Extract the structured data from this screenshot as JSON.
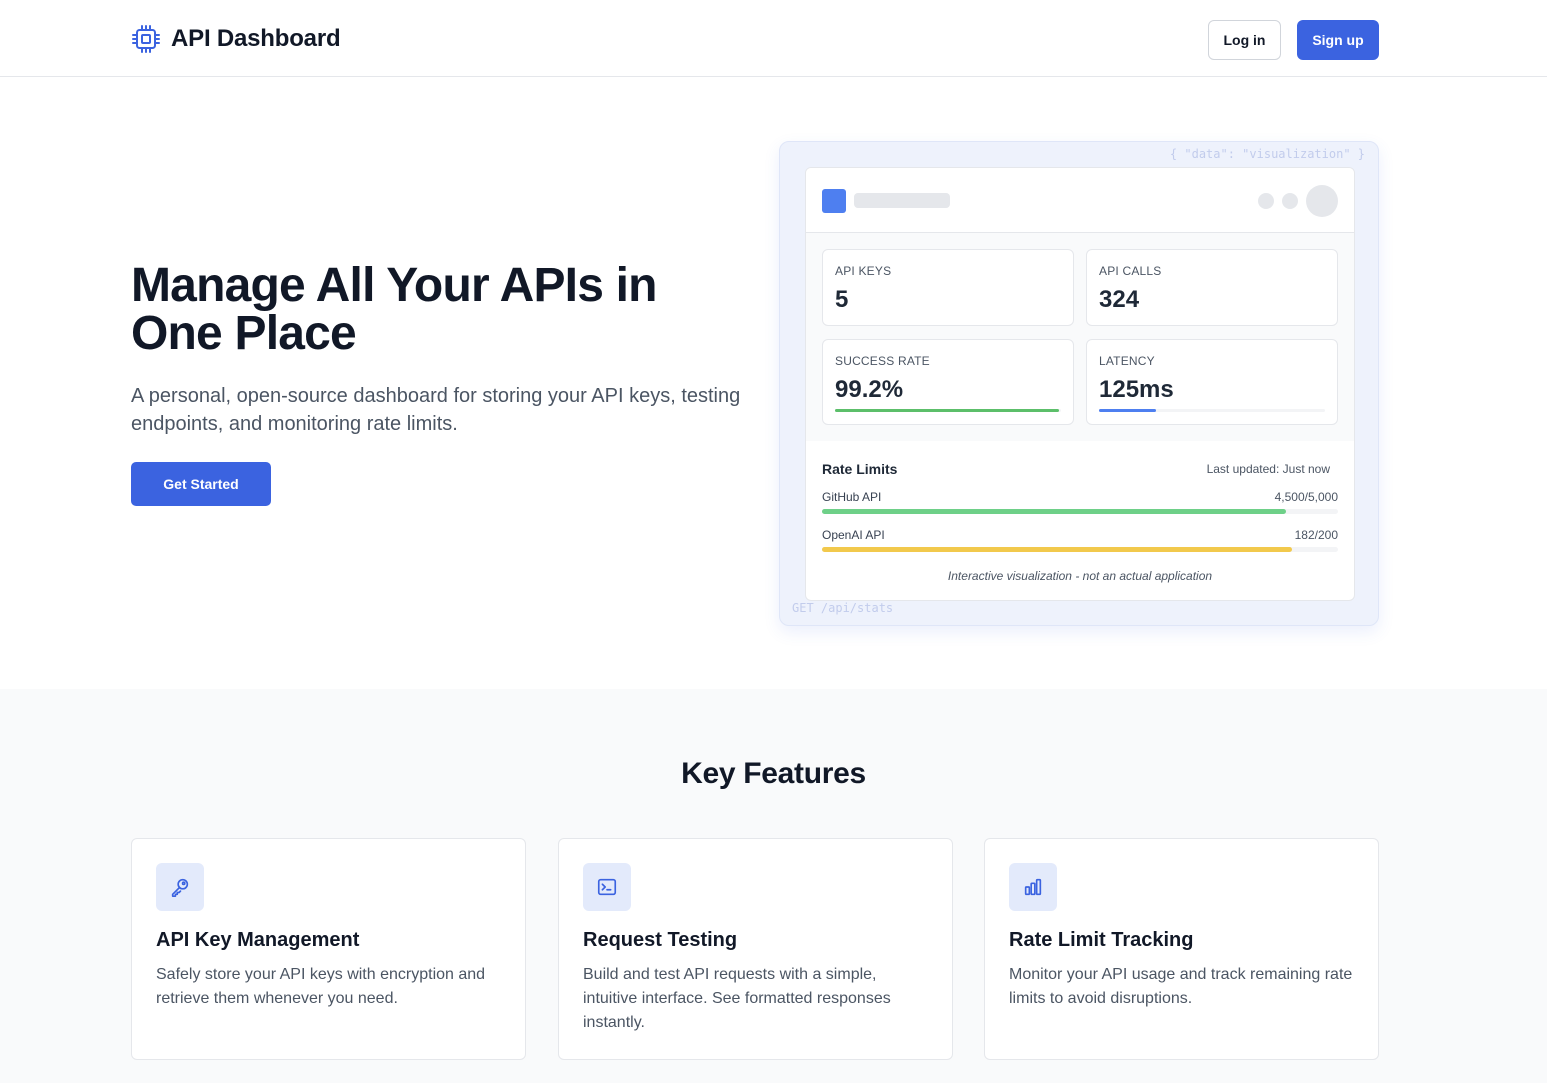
{
  "header": {
    "brand": "API Dashboard",
    "brand_icon": "cpu-chip-icon",
    "login_label": "Log in",
    "signup_label": "Sign up"
  },
  "hero": {
    "title": "Manage All Your APIs in One Place",
    "subtitle": "A personal, open-source dashboard for storing your API keys, testing endpoints, and monitoring rate limits.",
    "cta_label": "Get Started"
  },
  "visualization": {
    "code_top": "{ \"data\": \"visualization\" }",
    "code_bottom": "GET /api/stats",
    "stats": [
      {
        "label": "API KEYS",
        "value": "5"
      },
      {
        "label": "API CALLS",
        "value": "324"
      },
      {
        "label": "SUCCESS RATE",
        "value": "99.2%",
        "progress": 0.992,
        "color": "#5cbf6a"
      },
      {
        "label": "LATENCY",
        "value": "125ms",
        "progress": 0.25,
        "color": "#4e7ff0"
      }
    ],
    "rate_limits": {
      "title": "Rate Limits",
      "updated": "Last updated: Just now",
      "items": [
        {
          "name": "GitHub API",
          "count": "4,500/5,000",
          "fraction": 0.9,
          "color": "#6ed088"
        },
        {
          "name": "OpenAI API",
          "count": "182/200",
          "fraction": 0.91,
          "color": "#f2c94c"
        }
      ]
    },
    "note": "Interactive visualization - not an actual application"
  },
  "features": {
    "title": "Key Features",
    "cards": [
      {
        "icon": "key-icon",
        "title": "API Key Management",
        "desc": "Safely store your API keys with encryption and retrieve them whenever you need."
      },
      {
        "icon": "terminal-icon",
        "title": "Request Testing",
        "desc": "Build and test API requests with a simple, intuitive interface. See formatted responses instantly."
      },
      {
        "icon": "bar-chart-icon",
        "title": "Rate Limit Tracking",
        "desc": "Monitor your API usage and track remaining rate limits to avoid disruptions."
      }
    ]
  },
  "colors": {
    "accent": "#3b63e0",
    "icon_bg": "#e3eafb"
  }
}
